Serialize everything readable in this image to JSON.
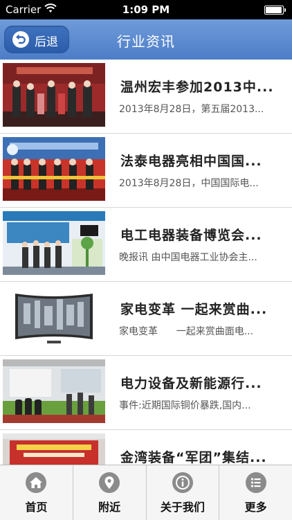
{
  "status_bar": {
    "carrier": "Carrier",
    "time": "1:09 PM"
  },
  "nav": {
    "back_label": "后退",
    "title": "行业资讯"
  },
  "news": [
    {
      "title": "温州宏丰参加2013中...",
      "desc": "2013年8月28日，第五届2013...",
      "thumb": "award-ceremony-photo"
    },
    {
      "title": "法泰电器亮相中国国...",
      "desc": "2013年8月28日，中国国际电...",
      "thumb": "expo-opening-photo"
    },
    {
      "title": "电工电器装备博览会...",
      "desc": "晚报讯 由中国电器工业协会主...",
      "thumb": "exhibition-booth-photo"
    },
    {
      "title": "家电变革 一起来赏曲...",
      "desc": "家电变革      一起来赏曲面电...",
      "thumb": "curved-tv-photo"
    },
    {
      "title": "电力设备及新能源行...",
      "desc": "事件:近期国际铜价暴跌,国内...",
      "thumb": "trade-show-photo"
    },
    {
      "title": "金湾装备“军团”集结...",
      "desc": "",
      "thumb": "banner-stage-photo"
    }
  ],
  "tabs": [
    {
      "label": "首页",
      "icon": "home-icon"
    },
    {
      "label": "附近",
      "icon": "location-pin-icon"
    },
    {
      "label": "关于我们",
      "icon": "info-icon"
    },
    {
      "label": "更多",
      "icon": "list-icon"
    }
  ],
  "colors": {
    "nav_bar": "#5a89cf",
    "back_button": "#3466b4",
    "tab_icon": "#8b8b8b"
  }
}
